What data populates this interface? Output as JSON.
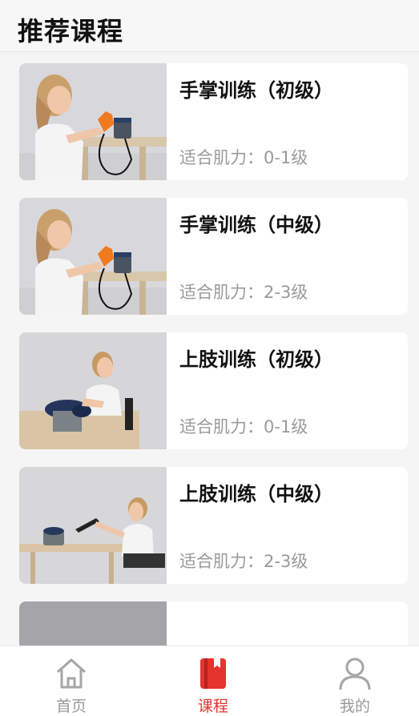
{
  "header": {
    "title": "推荐课程"
  },
  "courses": [
    {
      "title": "手掌训练（初级）",
      "level": "适合肌力：0-1级"
    },
    {
      "title": "手掌训练（中级）",
      "level": "适合肌力：2-3级"
    },
    {
      "title": "上肢训练（初级）",
      "level": "适合肌力：0-1级"
    },
    {
      "title": "上肢训练（中级）",
      "level": "适合肌力：2-3级"
    }
  ],
  "tabbar": {
    "items": [
      {
        "label": "首页",
        "icon": "home-icon",
        "active": false
      },
      {
        "label": "课程",
        "icon": "book-icon",
        "active": true
      },
      {
        "label": "我的",
        "icon": "user-icon",
        "active": false
      }
    ],
    "active_color": "#e5332d",
    "inactive_color": "#999999"
  }
}
